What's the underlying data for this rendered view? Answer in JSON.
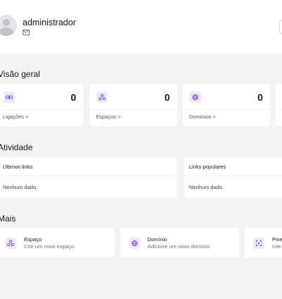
{
  "user": {
    "name": "administrador"
  },
  "overview": {
    "title": "Visão geral",
    "stats": [
      {
        "icon": "link-icon",
        "value": "0",
        "link": "Ligações"
      },
      {
        "icon": "spaces-icon",
        "value": "0",
        "link": "Espaços"
      },
      {
        "icon": "globe-icon",
        "value": "0",
        "link": "Domínios"
      }
    ]
  },
  "activity": {
    "title": "Atividade",
    "cards": [
      {
        "heading": "Últimos links",
        "empty": "Nenhum dado."
      },
      {
        "heading": "Links populares",
        "empty": "Nenhum dado."
      }
    ]
  },
  "more": {
    "title": "Mais",
    "items": [
      {
        "icon": "spaces-icon",
        "title": "Espaço",
        "desc": "Crie um novo espaço."
      },
      {
        "icon": "globe-icon",
        "title": "Domínio",
        "desc": "Adicione um novo domínio."
      },
      {
        "icon": "pixel-icon",
        "title": "Pixe",
        "desc": "Inte"
      }
    ]
  },
  "accent": "#7c3aed",
  "accent_bg": "#ede9fe"
}
